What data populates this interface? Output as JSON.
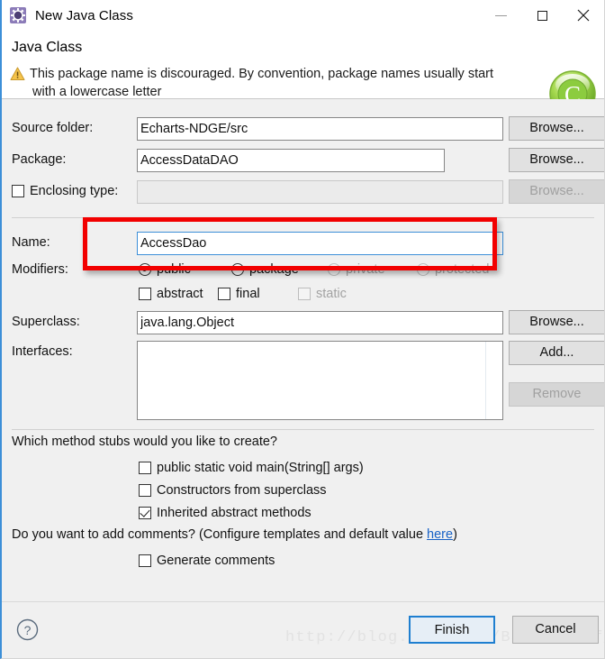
{
  "window": {
    "title": "New Java Class",
    "icon": "java-class-gear-icon",
    "controls": {
      "minimize": "minimize-icon",
      "maximize": "maximize-icon",
      "close": "close-icon"
    }
  },
  "header": {
    "title": "Java Class",
    "status_icon": "warning-icon",
    "message_line1": "This package name is discouraged. By convention, package names usually start",
    "message_line2": "with a lowercase letter",
    "badge": "C",
    "badge_color": "#7bc043"
  },
  "form": {
    "source_folder": {
      "label": "Source folder:",
      "value": "Echarts-NDGE/src",
      "button": "Browse..."
    },
    "package": {
      "label": "Package:",
      "value": "AccessDataDAO",
      "button": "Browse..."
    },
    "enclosing_type": {
      "label": "Enclosing type:",
      "value": "",
      "checked": false,
      "enabled": false,
      "button": "Browse..."
    },
    "name": {
      "label": "Name:",
      "value": "AccessDao",
      "focused": true
    },
    "modifiers": {
      "label": "Modifiers:",
      "radios": [
        {
          "label": "public",
          "selected": true,
          "enabled": true
        },
        {
          "label": "package",
          "selected": false,
          "enabled": true
        },
        {
          "label": "private",
          "selected": false,
          "enabled": false
        },
        {
          "label": "protected",
          "selected": false,
          "enabled": false
        }
      ],
      "checkboxes": [
        {
          "label": "abstract",
          "checked": false,
          "enabled": true
        },
        {
          "label": "final",
          "checked": false,
          "enabled": true
        },
        {
          "label": "static",
          "checked": false,
          "enabled": false
        }
      ]
    },
    "superclass": {
      "label": "Superclass:",
      "value": "java.lang.Object",
      "button": "Browse..."
    },
    "interfaces": {
      "label": "Interfaces:",
      "items": [],
      "add_button": "Add...",
      "remove_button": "Remove",
      "remove_enabled": false
    },
    "stubs": {
      "question": "Which method stubs would you like to create?",
      "options": [
        {
          "label": "public static void main(String[] args)",
          "checked": false
        },
        {
          "label": "Constructors from superclass",
          "checked": false
        },
        {
          "label": "Inherited abstract methods",
          "checked": true
        }
      ]
    },
    "comments": {
      "question_prefix": "Do you want to add comments? (Configure templates and default value ",
      "link": "here",
      "question_suffix": ")",
      "option": {
        "label": "Generate comments",
        "checked": false
      }
    }
  },
  "footer": {
    "help_icon": "help-icon",
    "finish": "Finish",
    "cancel": "Cancel",
    "watermark": "http://blog.csdn.net/BattleWolf_UA"
  },
  "annotation": {
    "color": "#f20000",
    "target": "name-field"
  }
}
